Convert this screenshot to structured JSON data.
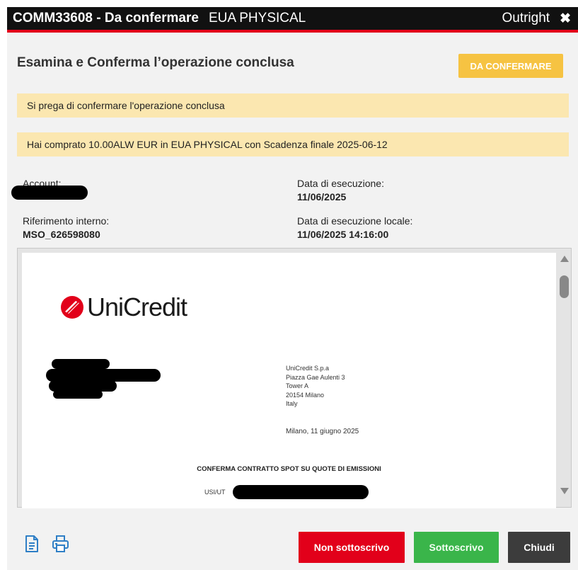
{
  "window": {
    "code": "COMM33608",
    "separator": " - ",
    "status": "Da confermare",
    "product": "EUA PHYSICAL",
    "type": "Outright",
    "close_glyph": "✖"
  },
  "header": {
    "title": "Esamina e Conferma l’operazione conclusa",
    "badge": "DA CONFERMARE"
  },
  "notices": [
    "Si prega di confermare l'operazione conclusa",
    "Hai comprato 10.00ALW EUR in EUA PHYSICAL con Scadenza finale 2025-06-12"
  ],
  "fields": {
    "account_label": "Account:",
    "exec_date_label": "Data di esecuzione:",
    "exec_date_value": "11/06/2025",
    "internal_ref_label": "Riferimento interno:",
    "internal_ref_value": "MSO_626598080",
    "local_exec_label": "Data di esecuzione locale:",
    "local_exec_value": "11/06/2025 14:16:00"
  },
  "document": {
    "logo_text": "UniCredit",
    "address": [
      "UniCredit S.p.a",
      "Piazza Gae Aulenti 3",
      "Tower A",
      "20154 Milano",
      "Italy"
    ],
    "place_date": "Milano, 11 giugno 2025",
    "title": "CONFERMA CONTRATTO SPOT SU QUOTE DI EMISSIONI",
    "usi_label": "USI/UT"
  },
  "footer": {
    "icons": [
      "document-icon",
      "print-icon"
    ],
    "buttons": {
      "reject": "Non sottoscrivo",
      "accept": "Sottoscrivo",
      "close": "Chiudi"
    }
  },
  "colors": {
    "brand_red": "#e2001a",
    "accept_green": "#3ab54a",
    "badge_yellow": "#f6c342",
    "notice_bg": "#fbe7b0",
    "icon_blue": "#2f7fc6"
  }
}
